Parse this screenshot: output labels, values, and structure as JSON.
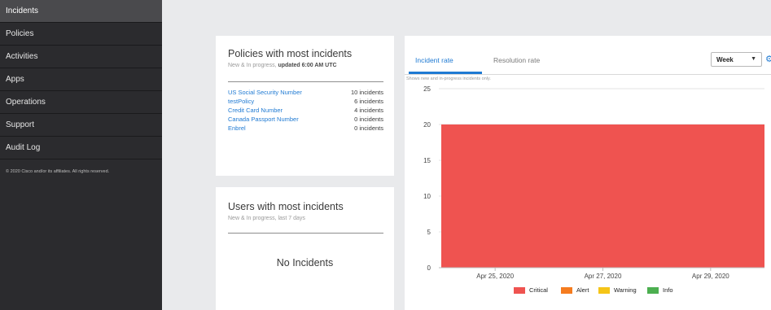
{
  "sidebar": {
    "items": [
      {
        "label": "Incidents"
      },
      {
        "label": "Policies"
      },
      {
        "label": "Activities"
      },
      {
        "label": "Apps"
      },
      {
        "label": "Operations"
      },
      {
        "label": "Support"
      },
      {
        "label": "Audit Log"
      }
    ],
    "copyright": "© 2020 Cisco and/or its affiliates. All rights reserved."
  },
  "policies_card": {
    "title": "Policies with most incidents",
    "subtitle_prefix": "New & In progress, ",
    "subtitle_bold": "updated 6:00 AM UTC",
    "rows": [
      {
        "name": "US Social Security Number",
        "count": "10 incidents"
      },
      {
        "name": "testPolicy",
        "count": "6 incidents"
      },
      {
        "name": "Credit Card Number",
        "count": "4 incidents"
      },
      {
        "name": "Canada Passport Number",
        "count": "0 incidents"
      },
      {
        "name": "Enbrel",
        "count": "0 incidents"
      }
    ]
  },
  "users_card": {
    "title": "Users with most incidents",
    "subtitle": "New & In progress, last 7 days",
    "empty_text": "No Incidents"
  },
  "chart_panel": {
    "tabs": [
      {
        "label": "Incident rate"
      },
      {
        "label": "Resolution rate"
      }
    ],
    "period": "Week",
    "note": "Shows new and in-progress incidents only.",
    "colors": {
      "critical": "#ef5350",
      "alert": "#f57c1f",
      "warning": "#f5c518",
      "info": "#4caf50",
      "accent": "#1f7ad3"
    }
  },
  "chart_data": {
    "type": "area",
    "x": [
      "Apr 24, 2020",
      "Apr 25, 2020",
      "Apr 26, 2020",
      "Apr 27, 2020",
      "Apr 28, 2020",
      "Apr 29, 2020",
      "Apr 30, 2020"
    ],
    "x_tick_labels": [
      "Apr 25, 2020",
      "Apr 27, 2020",
      "Apr 29, 2020"
    ],
    "y_ticks": [
      0,
      5,
      10,
      15,
      20,
      25
    ],
    "ylim": [
      0,
      25
    ],
    "grid": "horizontal",
    "legend": "bottom",
    "series": [
      {
        "name": "Critical",
        "color": "#ef5350",
        "values": [
          20,
          20,
          20,
          20,
          20,
          20,
          20
        ]
      },
      {
        "name": "Alert",
        "color": "#f57c1f",
        "values": [
          0,
          0,
          0,
          0,
          0,
          0,
          0
        ]
      },
      {
        "name": "Warning",
        "color": "#f5c518",
        "values": [
          0,
          0,
          0,
          0,
          0,
          0,
          0
        ]
      },
      {
        "name": "Info",
        "color": "#4caf50",
        "values": [
          0,
          0,
          0,
          0,
          0,
          0,
          0
        ]
      }
    ]
  }
}
